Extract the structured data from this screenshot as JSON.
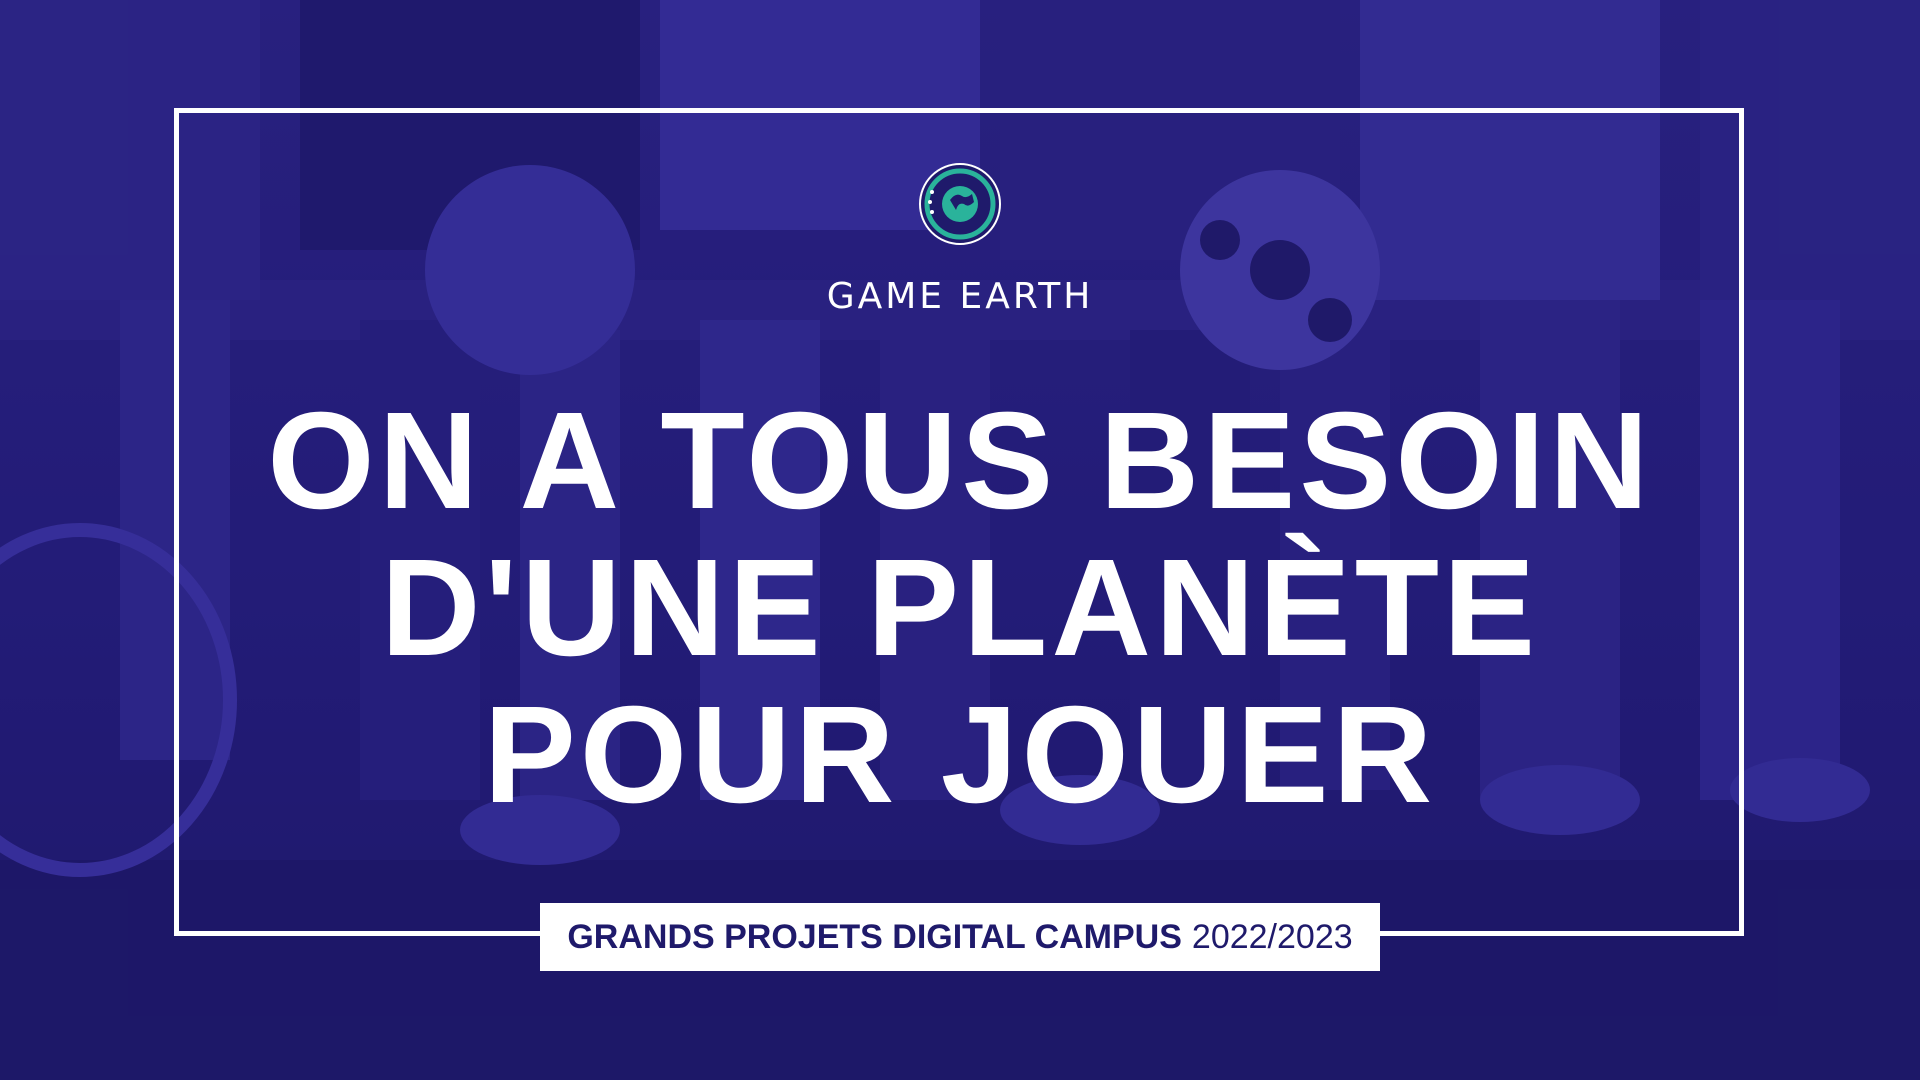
{
  "brand": {
    "logo_icon": "game-earth-globe-icon",
    "name": "GAME EARTH"
  },
  "headline": {
    "line1": "ON A TOUS BESOIN",
    "line2": "D'UNE PLANÈTE",
    "line3": "POUR JOUER"
  },
  "footer": {
    "label": "GRANDS PROJETS DIGITAL CAMPUS",
    "year": "2022/2023"
  },
  "colors": {
    "overlay": "#241e7d",
    "text": "#ffffff",
    "accent_text": "#1f1a6b",
    "logo_ring": "#2ab39b"
  }
}
